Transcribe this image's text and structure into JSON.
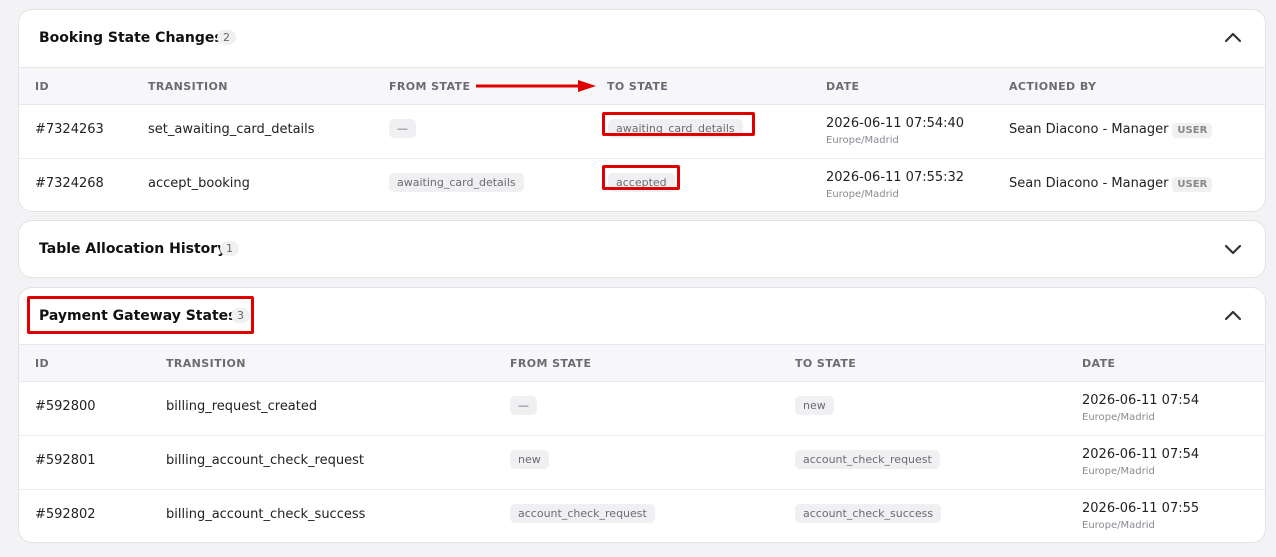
{
  "booking_state_changes": {
    "title": "Booking State Changes",
    "count": "2",
    "columns": [
      "ID",
      "TRANSITION",
      "FROM STATE",
      "TO STATE",
      "DATE",
      "ACTIONED BY"
    ],
    "rows": [
      {
        "id": "#7324263",
        "transition": "set_awaiting_card_details",
        "from": "—",
        "to": "awaiting_card_details",
        "date": "2026-06-11 07:54:40",
        "tz": "Europe/Madrid",
        "actioned_by": "Sean Diacono - Manager",
        "badge": "USER"
      },
      {
        "id": "#7324268",
        "transition": "accept_booking",
        "from": "awaiting_card_details",
        "to": "accepted",
        "date": "2026-06-11 07:55:32",
        "tz": "Europe/Madrid",
        "actioned_by": "Sean Diacono - Manager",
        "badge": "USER"
      }
    ]
  },
  "table_allocation_history": {
    "title": "Table Allocation History",
    "count": "1"
  },
  "payment_gateway_states": {
    "title": "Payment Gateway States",
    "count": "3",
    "columns": [
      "ID",
      "TRANSITION",
      "FROM STATE",
      "TO STATE",
      "DATE"
    ],
    "rows": [
      {
        "id": "#592800",
        "transition": "billing_request_created",
        "from": "—",
        "to": "new",
        "date": "2026-06-11 07:54",
        "tz": "Europe/Madrid"
      },
      {
        "id": "#592801",
        "transition": "billing_account_check_request",
        "from": "new",
        "to": "account_check_request",
        "date": "2026-06-11 07:54",
        "tz": "Europe/Madrid"
      },
      {
        "id": "#592802",
        "transition": "billing_account_check_success",
        "from": "account_check_request",
        "to": "account_check_success",
        "date": "2026-06-11 07:55",
        "tz": "Europe/Madrid"
      }
    ]
  },
  "annotation_color": "#e00000"
}
